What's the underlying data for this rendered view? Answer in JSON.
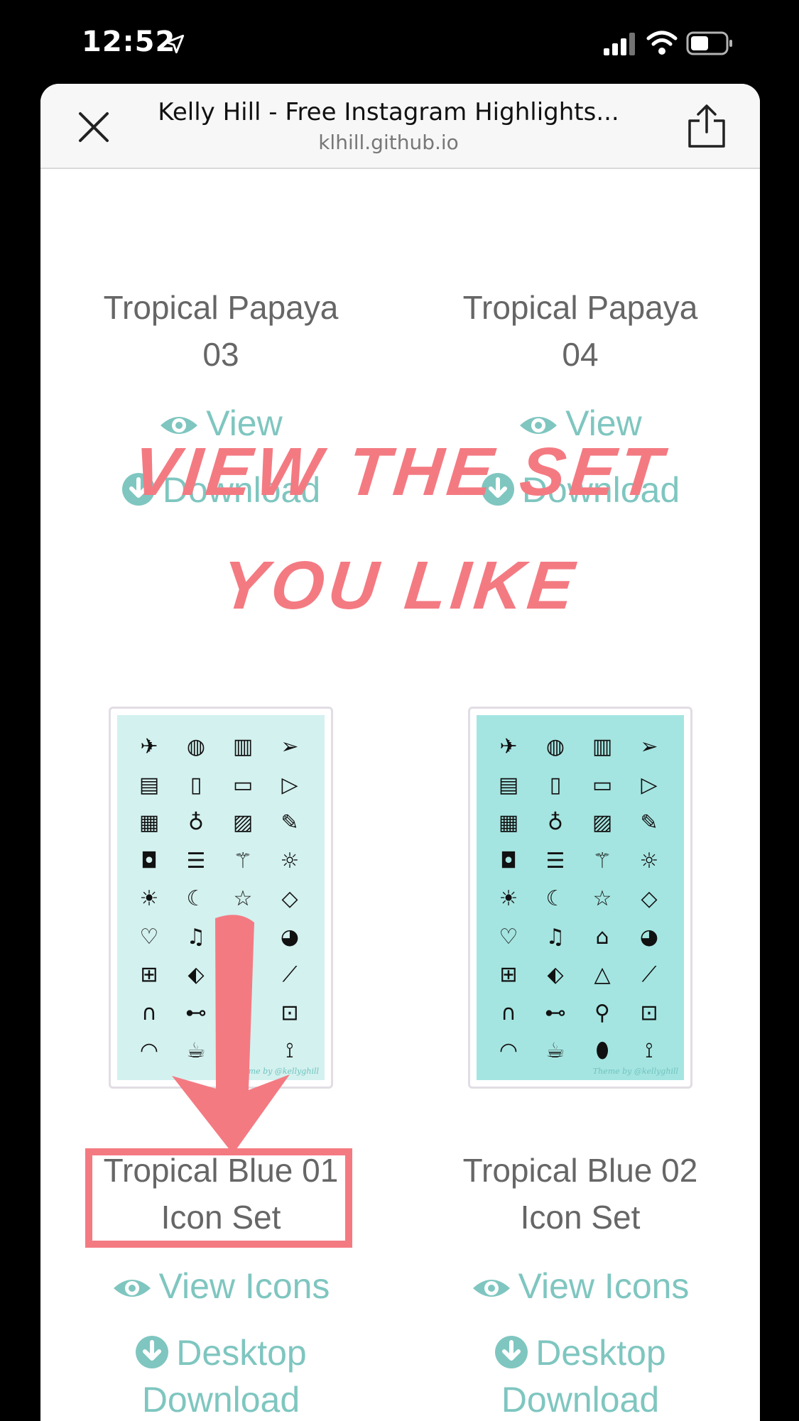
{
  "status_bar": {
    "time": "12:52"
  },
  "browser": {
    "title": "Kelly Hill - Free Instagram Highlights...",
    "url": "klhill.github.io"
  },
  "items_top": [
    {
      "title_line1": "Tropical Papaya",
      "title_line2": "03",
      "view_label": "View",
      "download_label": "Download"
    },
    {
      "title_line1": "Tropical Papaya",
      "title_line2": "04",
      "view_label": "View",
      "download_label": "Download"
    }
  ],
  "items_bottom": [
    {
      "title_line1": "Tropical Blue 01",
      "title_line2": "Icon Set",
      "view_label": "View Icons",
      "download_line1": "Desktop",
      "download_line2": "Download",
      "signature": "Theme by @kellyghill"
    },
    {
      "title_line1": "Tropical Blue 02",
      "title_line2": "Icon Set",
      "view_label": "View Icons",
      "download_line1": "Desktop",
      "download_line2": "Download",
      "signature": "Theme by @kellyghill"
    }
  ],
  "overlay": {
    "line1": "VIEW THE SET",
    "line2": "YOU LIKE"
  },
  "colors": {
    "accent_teal": "#7fc6c0",
    "overlay_pink": "#f47a82",
    "card1_bg": "#d3f1ef",
    "card2_bg": "#a5e5e1"
  }
}
